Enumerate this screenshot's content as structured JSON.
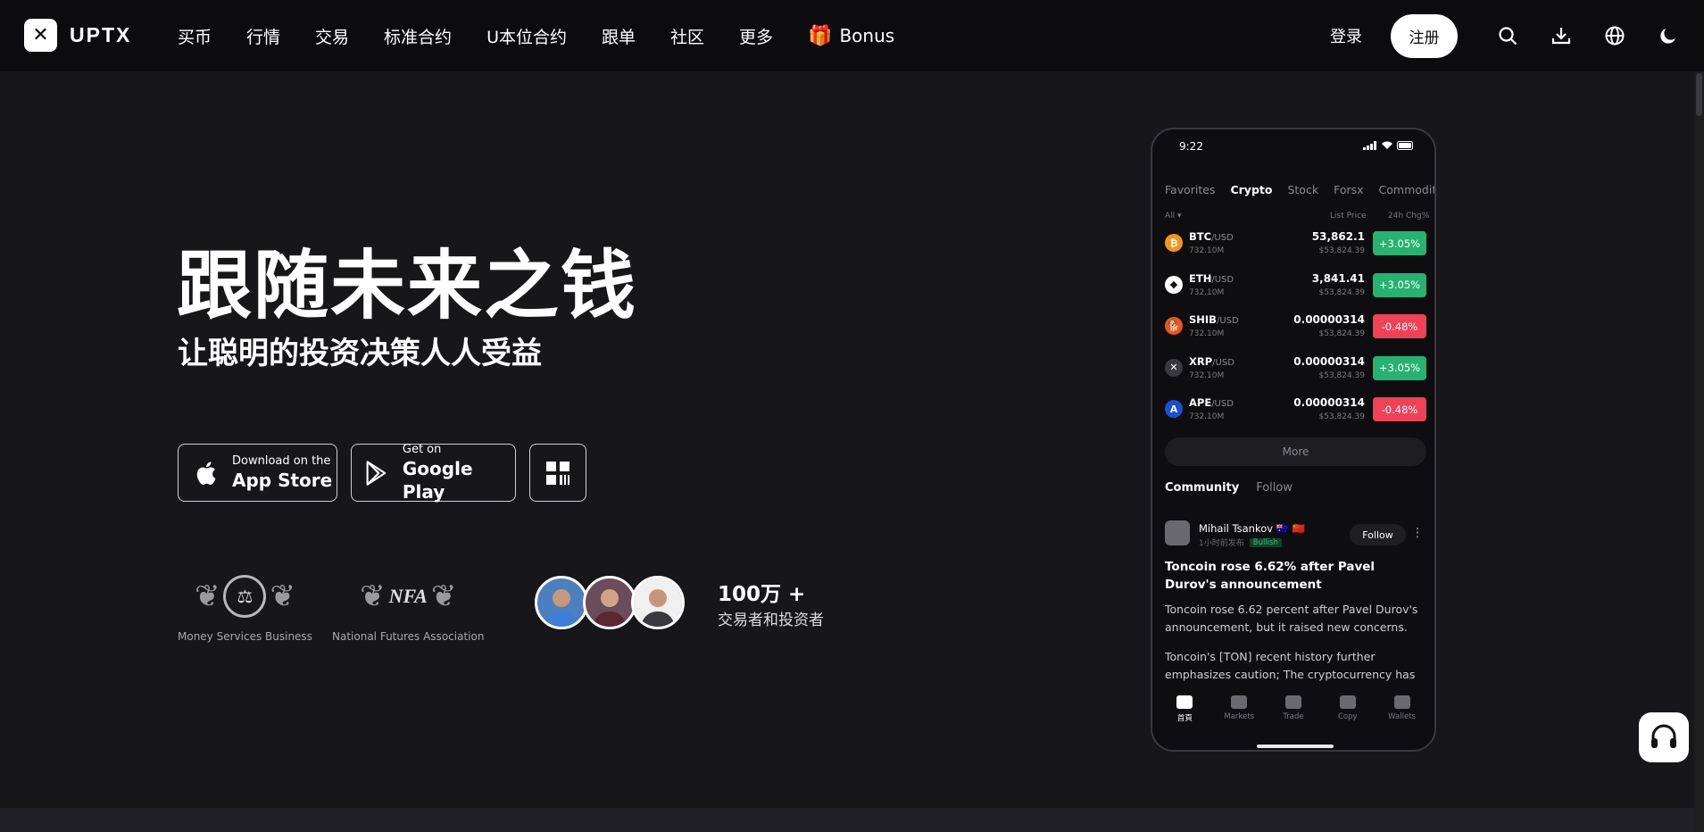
{
  "nav": {
    "logo_mark": "✕",
    "logo_text": "UPTX",
    "menu": [
      "买币",
      "行情",
      "交易",
      "标准合约",
      "U本位合约",
      "跟单",
      "社区",
      "更多"
    ],
    "bonus_label": "Bonus",
    "login": "登录",
    "register": "注册",
    "icons": [
      "search-icon",
      "download-icon",
      "globe-icon",
      "moon-icon"
    ]
  },
  "hero": {
    "headline": "跟随未来之钱",
    "subline": "让聪明的投资决策人人受益",
    "appstore": {
      "small": "Download on the",
      "big": "App Store"
    },
    "gplay": {
      "small": "Get on",
      "big": "Google Play"
    },
    "badges": [
      {
        "label": "Money Services Business"
      },
      {
        "label": "National Futures Association",
        "mark": "NFA"
      }
    ],
    "users_count": "100万 +",
    "users_label": "交易者和投资者"
  },
  "phone": {
    "time": "9:22",
    "tabs": [
      "Favorites",
      "Crypto",
      "Stock",
      "Forsx",
      "Commodity"
    ],
    "active_tab": "Crypto",
    "filter": "All ▾",
    "col_price": "List Price",
    "col_change": "24h Chg%",
    "rows": [
      {
        "sym": "BTC",
        "quote": "/USD",
        "vol": "732.10M",
        "price": "53,862.1",
        "usd": "$53,824.39",
        "change": "+3.05%",
        "dir": "up",
        "icon_color": "#f7931a",
        "icon": "₿"
      },
      {
        "sym": "ETH",
        "quote": "/USD",
        "vol": "732.10M",
        "price": "3,841.41",
        "usd": "$53,824.39",
        "change": "+3.05%",
        "dir": "up",
        "icon_color": "#ffffff",
        "icon": "◆"
      },
      {
        "sym": "SHIB",
        "quote": "/USD",
        "vol": "732.10M",
        "price": "0.00000314",
        "usd": "$53,824.39",
        "change": "-0.48%",
        "dir": "down",
        "icon_color": "#e8561c",
        "icon": "🐕"
      },
      {
        "sym": "XRP",
        "quote": "/USD",
        "vol": "732.10M",
        "price": "0.00000314",
        "usd": "$53,824.39",
        "change": "+3.05%",
        "dir": "up",
        "icon_color": "#3a3a3e",
        "icon": "✕"
      },
      {
        "sym": "APE",
        "quote": "/USD",
        "vol": "732.10M",
        "price": "0.00000314",
        "usd": "$53,824.39",
        "change": "-0.48%",
        "dir": "down",
        "icon_color": "#1a4fd8",
        "icon": "A"
      }
    ],
    "more": "More",
    "community_tabs": [
      "Community",
      "Follow"
    ],
    "post": {
      "author": "Mihail Tsankov 🇦🇺 🇨🇳",
      "meta": "1小时前发布",
      "tag": "Bullish",
      "follow": "Follow",
      "title": "Toncoin rose 6.62% after Pavel Durov's announcement",
      "body1": "Toncoin rose 6.62 percent after Pavel Durov's announcement, but it raised new concerns.",
      "body2": "Toncoin's [TON] recent history further emphasizes caution; The cryptocurrency has experienced a si…"
    },
    "tabbar": [
      "首頁",
      "Markets",
      "Trade",
      "Copy",
      "Wallets"
    ]
  },
  "colors": {
    "up": "#26b270",
    "down": "#ef4256",
    "bg": "#17171a",
    "nav_bg": "#0c0c0e"
  }
}
